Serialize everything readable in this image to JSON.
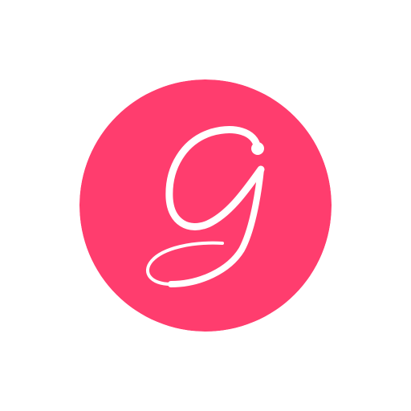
{
  "logo": {
    "icon": "script-letter-g-logo",
    "lettering": "g",
    "colors": {
      "background": "#ffffff",
      "circle": "#ff3d6e",
      "glyph": "#ffffff"
    }
  }
}
